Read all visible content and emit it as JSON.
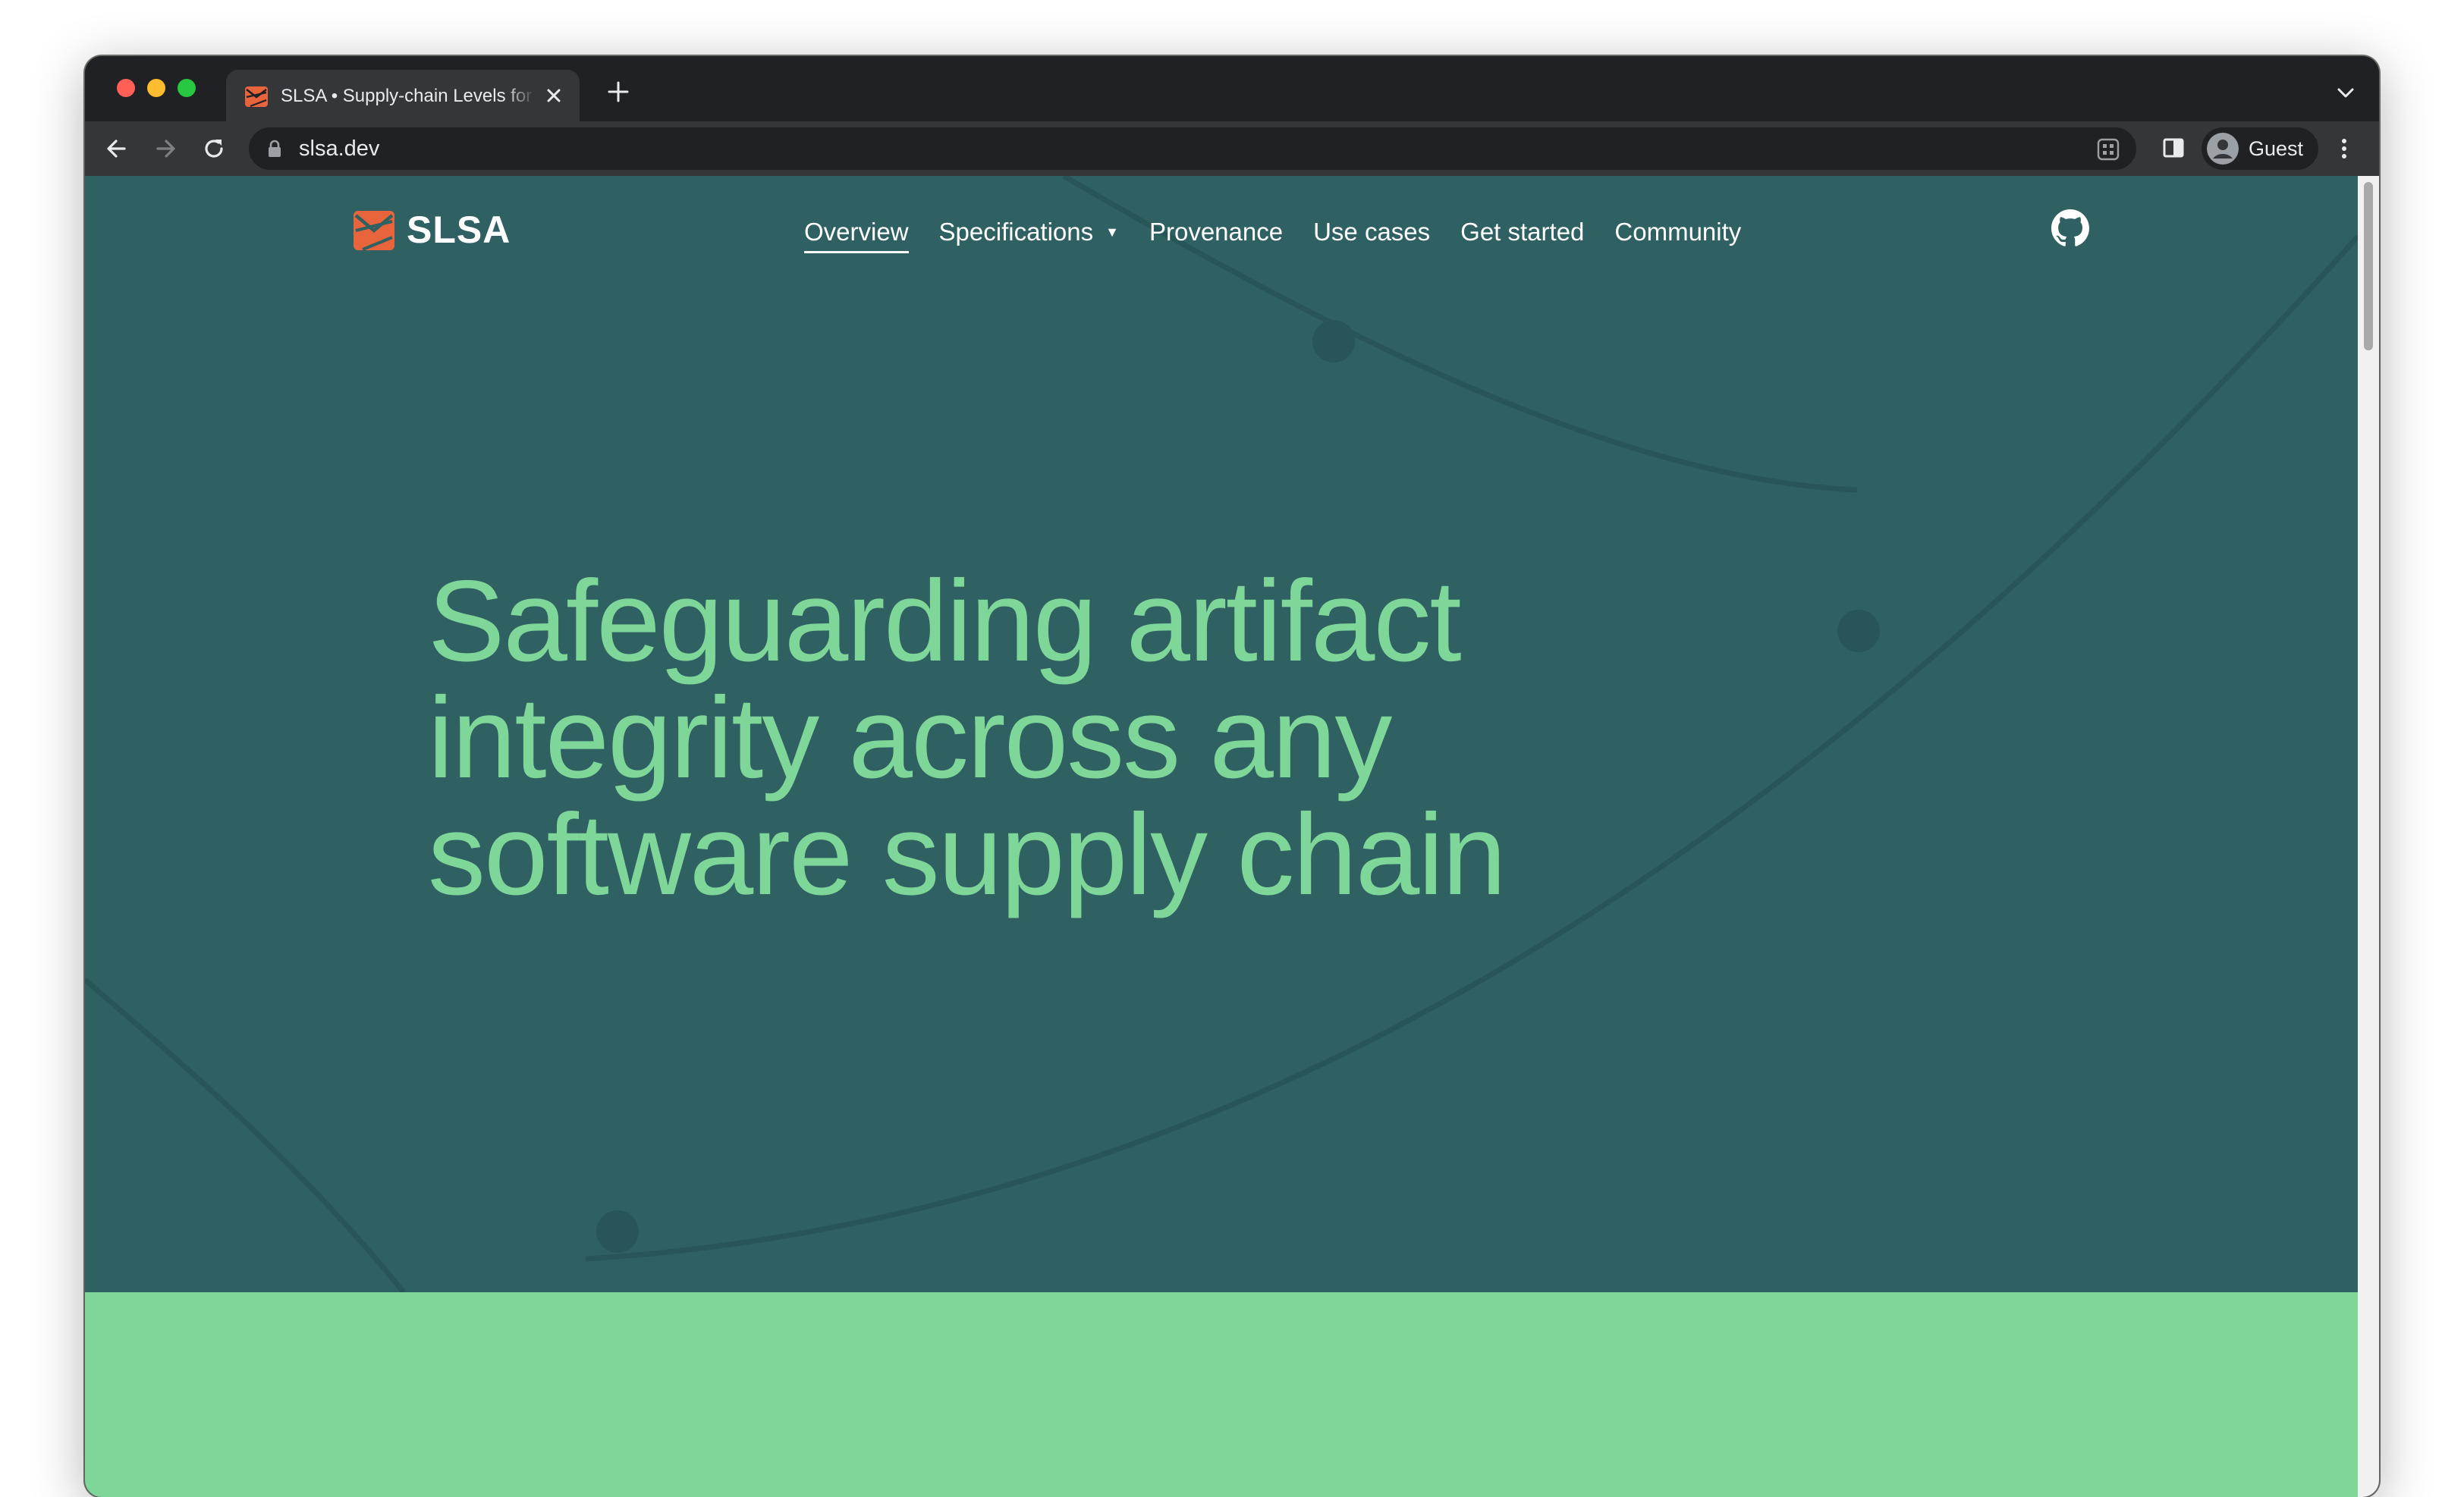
{
  "browser": {
    "tab": {
      "title": "SLSA • Supply-chain Levels for Software Artifacts",
      "favicon": "slsa-logo-icon"
    },
    "toolbar": {
      "url": "slsa.dev",
      "profile_name": "Guest"
    },
    "icons": [
      "back-icon",
      "forward-icon",
      "reload-icon",
      "lock-icon",
      "apps-icon",
      "side-panel-icon",
      "avatar-icon",
      "menu-icon",
      "close-icon",
      "plus-icon",
      "chevron-down-icon"
    ]
  },
  "site": {
    "logo_text": "SLSA",
    "nav": [
      {
        "label": "Overview",
        "active": true
      },
      {
        "label": "Specifications",
        "has_dropdown": true,
        "caret": "▼"
      },
      {
        "label": "Provenance"
      },
      {
        "label": "Use cases"
      },
      {
        "label": "Get started"
      },
      {
        "label": "Community"
      }
    ],
    "github_icon": "github-icon",
    "headline_lines": [
      "Safeguarding artifact",
      "integrity across any",
      "software supply chain"
    ]
  },
  "colors": {
    "hero_bg": "#2f6062",
    "accent_green": "#7fd699",
    "logo_orange": "#e8643c",
    "chrome_dark": "#202124",
    "chrome_toolbar": "#35363a"
  }
}
